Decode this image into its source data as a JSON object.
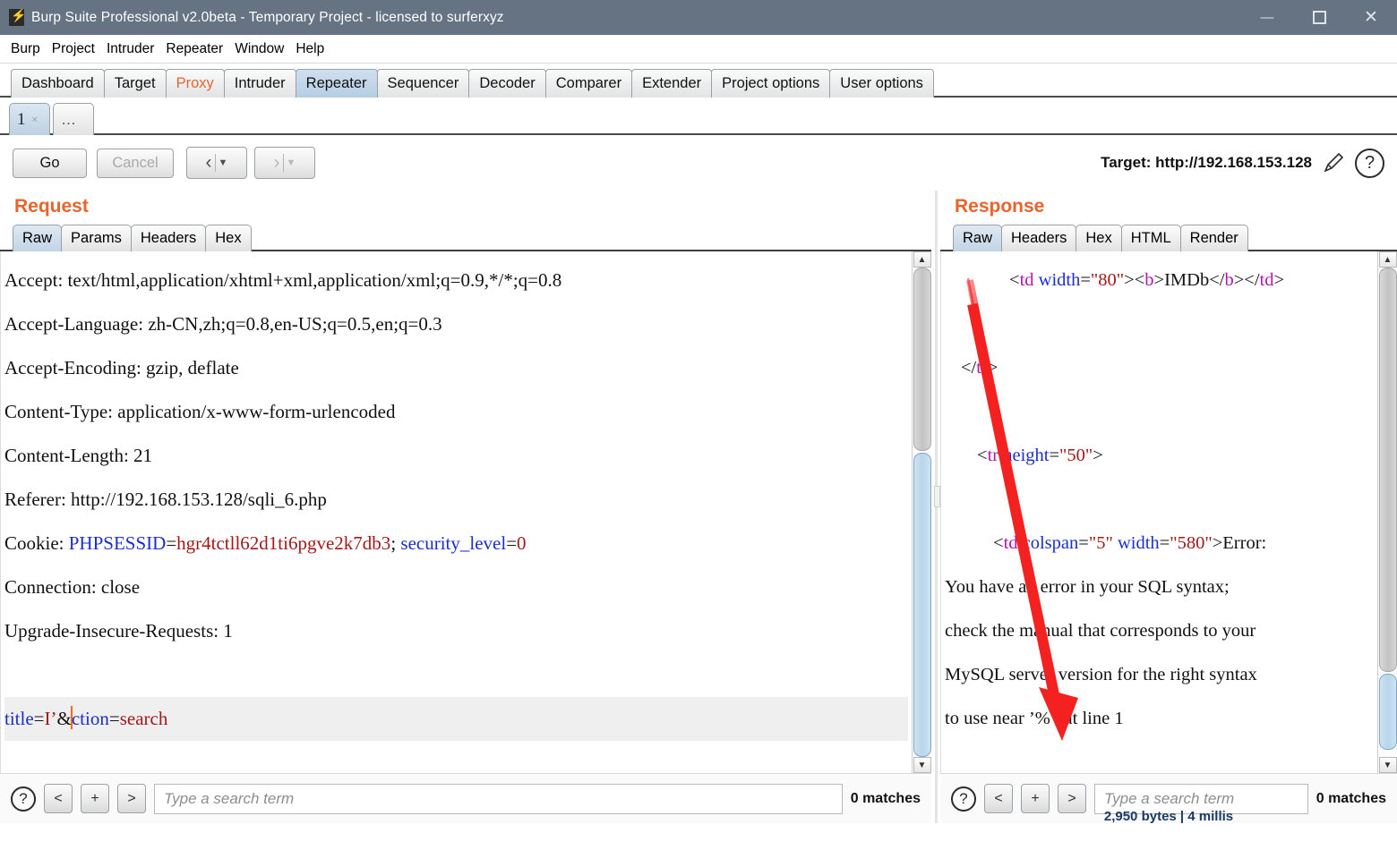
{
  "window": {
    "title": "Burp Suite Professional v2.0beta - Temporary Project - licensed to surferxyz",
    "logo_icon": "burp-logo-icon",
    "minimize": "—",
    "maximize": "☐",
    "close": "✕"
  },
  "menu": [
    "Burp",
    "Project",
    "Intruder",
    "Repeater",
    "Window",
    "Help"
  ],
  "main_tabs": [
    {
      "label": "Dashboard",
      "state": "normal"
    },
    {
      "label": "Target",
      "state": "normal"
    },
    {
      "label": "Proxy",
      "state": "highlight"
    },
    {
      "label": "Intruder",
      "state": "normal"
    },
    {
      "label": "Repeater",
      "state": "active"
    },
    {
      "label": "Sequencer",
      "state": "normal"
    },
    {
      "label": "Decoder",
      "state": "normal"
    },
    {
      "label": "Comparer",
      "state": "normal"
    },
    {
      "label": "Extender",
      "state": "normal"
    },
    {
      "label": "Project options",
      "state": "normal"
    },
    {
      "label": "User options",
      "state": "normal"
    }
  ],
  "repeater_tabs": {
    "number": "1",
    "close": "×",
    "more": "…"
  },
  "toolbar": {
    "go_label": "Go",
    "cancel_label": "Cancel",
    "back_arrow": "‹",
    "forward_arrow": "›",
    "caret": "▼",
    "target_label": "Target: http://192.168.153.128",
    "pencil_icon": "pencil-icon",
    "help_icon": "question-mark-icon",
    "help_glyph": "?"
  },
  "request": {
    "title": "Request",
    "tabs": [
      "Raw",
      "Params",
      "Headers",
      "Hex"
    ],
    "active_tab": "Raw",
    "lines": [
      {
        "segments": [
          {
            "t": "Accept: text/html,application/xhtml+xml,application/xml;q=0.9,*/*;q=0.8",
            "c": "black"
          }
        ]
      },
      {
        "segments": [
          {
            "t": "Accept-Language: zh-CN,zh;q=0.8,en-US;q=0.5,en;q=0.3",
            "c": "black"
          }
        ]
      },
      {
        "segments": [
          {
            "t": "Accept-Encoding: gzip, deflate",
            "c": "black"
          }
        ]
      },
      {
        "segments": [
          {
            "t": "Content-Type: application/x-www-form-urlencoded",
            "c": "black"
          }
        ]
      },
      {
        "segments": [
          {
            "t": "Content-Length: 21",
            "c": "black"
          }
        ]
      },
      {
        "segments": [
          {
            "t": "Referer: http://192.168.153.128/sqli_6.php",
            "c": "black"
          }
        ]
      },
      {
        "segments": [
          {
            "t": "Cookie: ",
            "c": "black"
          },
          {
            "t": "PHPSESSID",
            "c": "blue"
          },
          {
            "t": "=",
            "c": "black"
          },
          {
            "t": "hgr4tctll62d1ti6pgve2k7db3",
            "c": "dred"
          },
          {
            "t": "; ",
            "c": "black"
          },
          {
            "t": "security_level",
            "c": "blue"
          },
          {
            "t": "=",
            "c": "black"
          },
          {
            "t": "0",
            "c": "dred"
          }
        ]
      },
      {
        "segments": [
          {
            "t": "Connection: close",
            "c": "black"
          }
        ]
      },
      {
        "segments": [
          {
            "t": "Upgrade-Insecure-Requests: 1",
            "c": "black"
          }
        ]
      },
      {
        "segments": []
      },
      {
        "highlight": true,
        "segments": [
          {
            "t": "title",
            "c": "blue"
          },
          {
            "t": "=",
            "c": "black"
          },
          {
            "t": "I’",
            "c": "dred"
          },
          {
            "t": "&",
            "c": "black"
          },
          {
            "caret": true
          },
          {
            "t": "ction",
            "c": "blue"
          },
          {
            "t": "=",
            "c": "black"
          },
          {
            "t": "search",
            "c": "dred"
          }
        ]
      }
    ],
    "search": {
      "help_glyph": "?",
      "prev": "<",
      "add": "+",
      "next": ">",
      "placeholder": "Type a search term",
      "value": "",
      "matches": "0 matches"
    }
  },
  "response": {
    "title": "Response",
    "tabs": [
      "Raw",
      "Headers",
      "Hex",
      "HTML",
      "Render"
    ],
    "active_tab": "Raw",
    "lines": [
      {
        "indent": 4,
        "segments": [
          {
            "t": "<",
            "c": "black"
          },
          {
            "t": "td",
            "c": "purple"
          },
          {
            "t": " ",
            "c": "black"
          },
          {
            "t": "width",
            "c": "blue"
          },
          {
            "t": "=",
            "c": "black"
          },
          {
            "t": "\"80\"",
            "c": "dred"
          },
          {
            "t": "><",
            "c": "black"
          },
          {
            "t": "b",
            "c": "purple"
          },
          {
            "t": ">IMDb</",
            "c": "black"
          },
          {
            "t": "b",
            "c": "purple"
          },
          {
            "t": "></",
            "c": "black"
          },
          {
            "t": "td",
            "c": "purple"
          },
          {
            "t": ">",
            "c": "black"
          }
        ]
      },
      {
        "segments": []
      },
      {
        "indent": 1,
        "segments": [
          {
            "t": "</",
            "c": "black"
          },
          {
            "t": "tr",
            "c": "purple"
          },
          {
            "t": ">",
            "c": "black"
          }
        ]
      },
      {
        "segments": []
      },
      {
        "indent": 2,
        "segments": [
          {
            "t": "<",
            "c": "black"
          },
          {
            "t": "tr",
            "c": "purple"
          },
          {
            "t": " ",
            "c": "black"
          },
          {
            "t": "height",
            "c": "blue"
          },
          {
            "t": "=",
            "c": "black"
          },
          {
            "t": "\"50\"",
            "c": "dred"
          },
          {
            "t": ">",
            "c": "black"
          }
        ]
      },
      {
        "segments": []
      },
      {
        "indent": 3,
        "segments": [
          {
            "t": "<",
            "c": "black"
          },
          {
            "t": "td",
            "c": "purple"
          },
          {
            "t": " ",
            "c": "black"
          },
          {
            "t": "colspan",
            "c": "blue"
          },
          {
            "t": "=",
            "c": "black"
          },
          {
            "t": "\"5\"",
            "c": "dred"
          },
          {
            "t": " ",
            "c": "black"
          },
          {
            "t": "width",
            "c": "blue"
          },
          {
            "t": "=",
            "c": "black"
          },
          {
            "t": "\"580\"",
            "c": "dred"
          },
          {
            "t": ">Error:",
            "c": "black"
          }
        ]
      },
      {
        "segments": [
          {
            "t": "You have an error in your SQL syntax;",
            "c": "black"
          }
        ]
      },
      {
        "segments": [
          {
            "t": "check the manual that corresponds to your",
            "c": "black"
          }
        ]
      },
      {
        "segments": [
          {
            "t": "MySQL server version for the right syntax",
            "c": "black"
          }
        ]
      },
      {
        "segments": [
          {
            "t": "to use near ’%’’ at line 1",
            "c": "black"
          }
        ]
      }
    ],
    "search": {
      "help_glyph": "?",
      "prev": "<",
      "add": "+",
      "next": ">",
      "placeholder": "Type a search term",
      "value": "",
      "matches": "0 matches"
    },
    "status": "2,950 bytes | 4 millis"
  },
  "annotation": {
    "type": "red-arrow",
    "color": "#f42121"
  }
}
